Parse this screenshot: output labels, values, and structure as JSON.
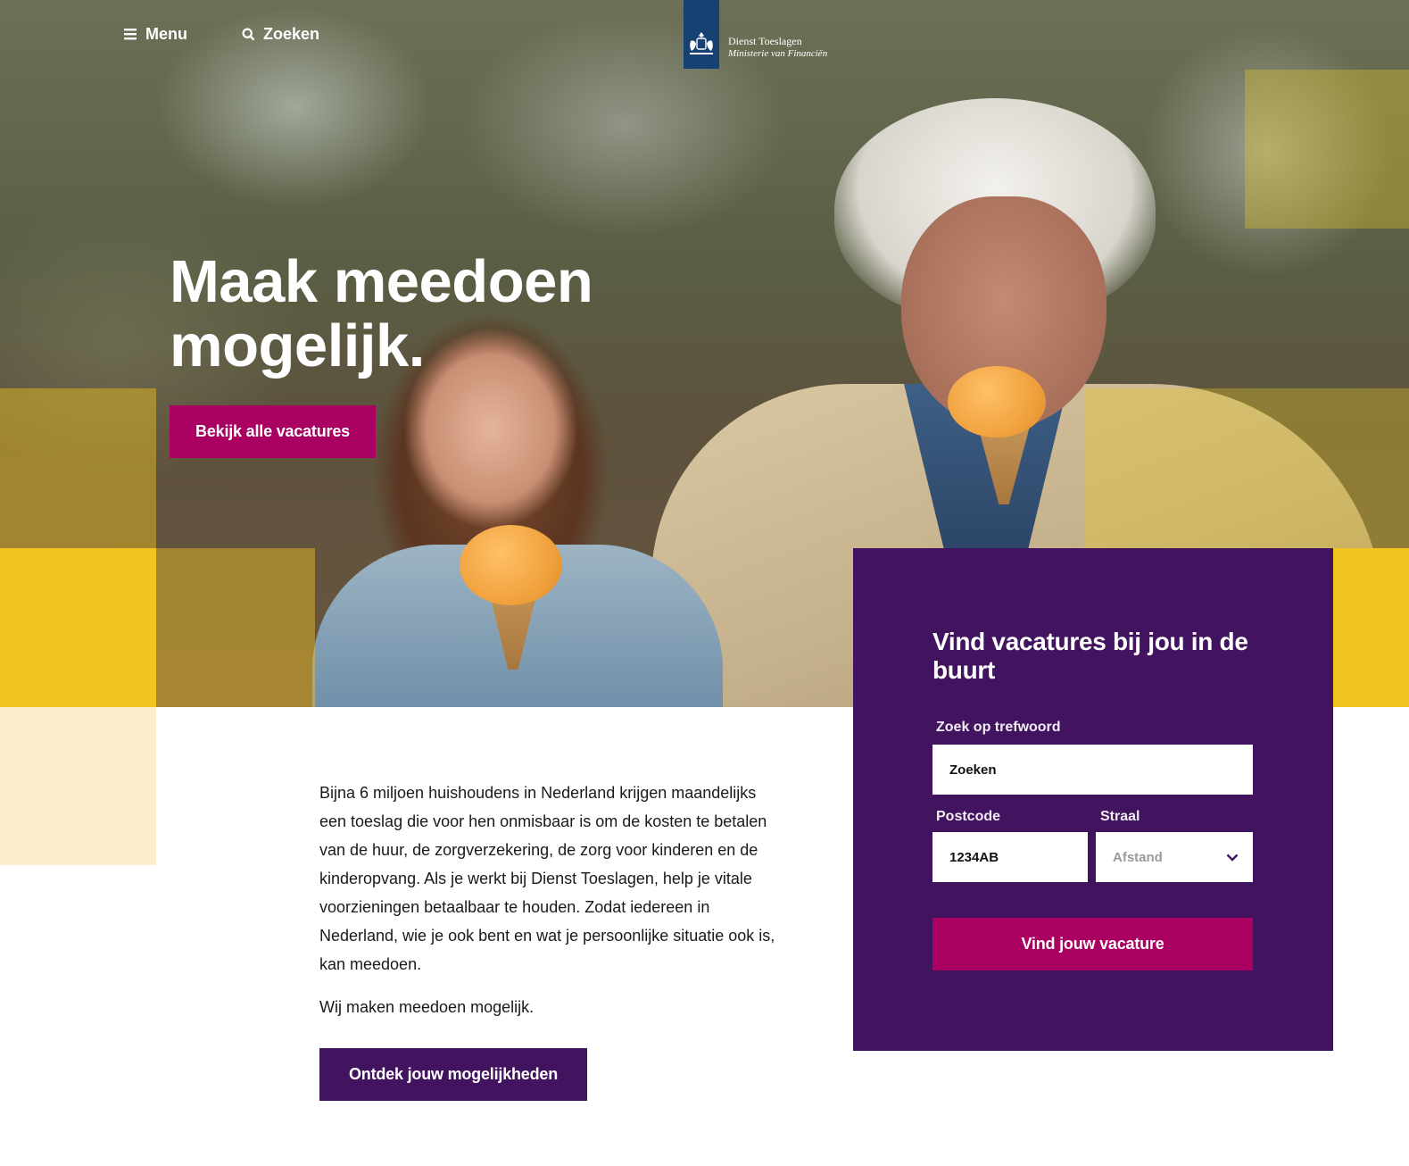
{
  "nav": {
    "menu_label": "Menu",
    "search_label": "Zoeken"
  },
  "logo": {
    "line1": "Dienst Toeslagen",
    "line2": "Ministerie van Financiën"
  },
  "hero": {
    "title": "Maak meedoen mogelijk.",
    "cta_label": "Bekijk alle vacatures"
  },
  "search_panel": {
    "title": "Vind vacatures bij jou in de buurt",
    "keyword_label": "Zoek op trefwoord",
    "keyword_value": "Zoeken",
    "postcode_label": "Postcode",
    "postcode_value": "1234AB",
    "radius_label": "Straal",
    "radius_selected": "Afstand",
    "submit_label": "Vind jouw vacature"
  },
  "intro": {
    "paragraph": "Bijna 6 miljoen huishoudens in Nederland krijgen maandelijks een toeslag die voor hen onmisbaar is om de kosten te betalen van de huur, de zorgverzekering, de zorg voor kinderen en de kinderopvang. Als je werkt bij Dienst Toeslagen, help je vitale voorzieningen betaalbaar te houden. Zodat iedereen in Nederland, wie je ook bent en wat je persoonlijke situatie ook is, kan meedoen.",
    "tagline": "Wij maken meedoen mogelijk.",
    "cta_label": "Ontdek jouw mogelijkheden"
  },
  "colors": {
    "magenta": "#a90061",
    "purple": "#42145f",
    "yellow": "#f2c41f",
    "rijks_blue": "#154273",
    "cream": "#fdefcc"
  },
  "icons": [
    "hamburger-icon",
    "search-icon",
    "coat-of-arms-icon",
    "chevron-down-icon"
  ]
}
